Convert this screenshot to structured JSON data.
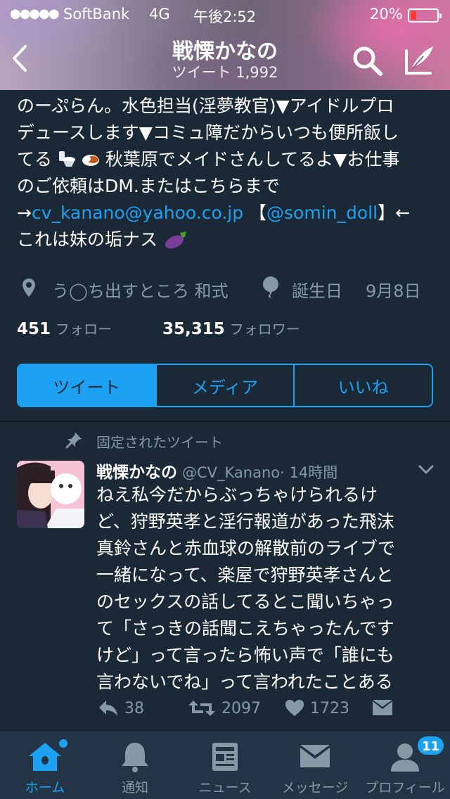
{
  "status_bar": {
    "signal": "●●●●●",
    "carrier": "SoftBank",
    "network": "4G",
    "time": "午後2:52",
    "battery": "20%",
    "battery_level": 0.2
  },
  "header": {
    "title": "戦慄かなの",
    "subtitle": "ツイート 1,992"
  },
  "bio": {
    "line1": "のーぷらん。水色担当(淫夢教官)▼アイドルプロ",
    "line2": "デュースします▼コミュ障だからいつも便所飯し",
    "line3_a": "てる",
    "line3_b": "秋葉原でメイドさんしてるよ▼お仕事",
    "line4": "のご依頼はDM.またはこちらまで",
    "line5_arrow": "→",
    "line5_email": "cv_kanano@yahoo.co.jp",
    "line5_open": " 【",
    "line5_mention": "@somin_doll",
    "line5_close": "】←",
    "line6": "これは妹の垢ナス"
  },
  "profile_meta": {
    "location": "う◯ち出すところ 和式",
    "birthday_label": "誕生日",
    "birthday": "9月8日"
  },
  "stats": {
    "following_count": "451",
    "following_label": "フォロー",
    "followers_count": "35,315",
    "followers_label": "フォロワー"
  },
  "tabs": [
    {
      "label": "ツイート",
      "active": true
    },
    {
      "label": "メディア",
      "active": false
    },
    {
      "label": "いいね",
      "active": false
    }
  ],
  "tweet": {
    "pinned_label": "固定されたツイート",
    "name": "戦慄かなの",
    "handle": "@CV_Kanano",
    "time": "· 14時間",
    "lines": [
      "ねえ私今だからぶっちゃけられるけ",
      "ど、狩野英孝と淫行報道があった飛沫",
      "真鈴さんと赤血球の解散前のライブで",
      "一緒になって、楽屋で狩野英孝さんと",
      "のセックスの話してるとこ聞いちゃっ",
      "て「さっきの話聞こえちゃったんです",
      "けど」って言ったら怖い声で「誰にも",
      "言わないでね」って言われたことある"
    ],
    "replies": "38",
    "retweets": "2097",
    "likes": "1723"
  },
  "tabbar": {
    "home": "ホーム",
    "notifications": "通知",
    "news": "ニュース",
    "messages": "メッセージ",
    "profile": "プロフィール",
    "profile_badge": "11"
  },
  "colors": {
    "background": "#1b2836",
    "accent": "#1da1f2",
    "secondary_text": "#8899a6",
    "tabbar": "#243447"
  }
}
